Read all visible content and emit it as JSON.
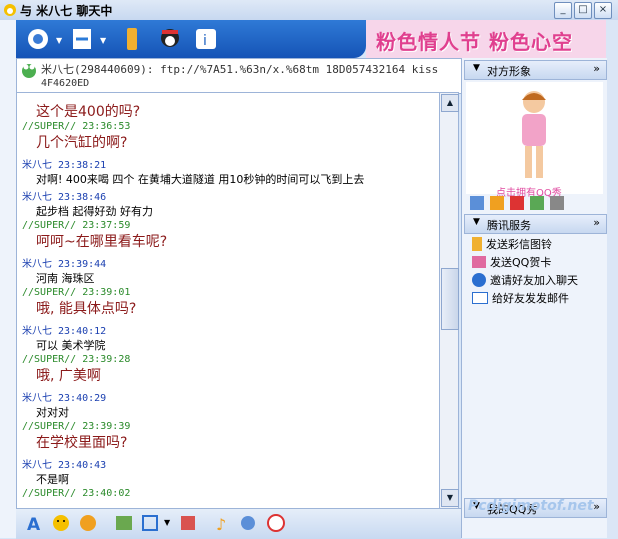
{
  "title": "与 米八七 聊天中",
  "window_controls": [
    "_",
    "□",
    "×"
  ],
  "banner_text": "粉色情人节 粉色心空",
  "header": {
    "line1": "米八七(298440609): ftp://%7A51.%63n/x.%68tm 18D057432164  kiss",
    "line2": "4F4620ED"
  },
  "messages": [
    {
      "who": "SUPER",
      "time": "//SUPER// 23:36:53",
      "text": "几个汽缸的啊?",
      "style": "big"
    },
    {
      "who": "米八七",
      "time": "米八七 23:38:21",
      "text": "对啊! 400来喝  四个   在黄埔大道隧道   用10秒钟的时间可以飞到上去",
      "style": "small"
    },
    {
      "who": "米八七",
      "time": "米八七 23:38:46",
      "text": "起步档 起得好劲 好有力",
      "style": "small"
    },
    {
      "who": "SUPER",
      "time": "//SUPER// 23:37:59",
      "text": "呵呵~在哪里看车呢?",
      "style": "big"
    },
    {
      "who": "米八七",
      "time": "米八七 23:39:44",
      "text": "河南 海珠区",
      "style": "small"
    },
    {
      "who": "SUPER",
      "time": "//SUPER// 23:39:01",
      "text": "哦, 能具体点吗?",
      "style": "big"
    },
    {
      "who": "米八七",
      "time": "米八七 23:40:12",
      "text": "可以 美术学院",
      "style": "small"
    },
    {
      "who": "SUPER",
      "time": "//SUPER// 23:39:28",
      "text": "哦, 广美啊",
      "style": "big"
    },
    {
      "who": "米八七",
      "time": "米八七 23:40:29",
      "text": "对对对",
      "style": "small"
    },
    {
      "who": "SUPER",
      "time": "//SUPER// 23:39:39",
      "text": "在学校里面吗?",
      "style": "big"
    },
    {
      "who": "米八七",
      "time": "米八七 23:40:43",
      "text": "不是啊",
      "style": "small"
    },
    {
      "who": "SUPER",
      "time": "//SUPER// 23:40:02",
      "text": "",
      "style": "big"
    }
  ],
  "top_partial": "这个是400的吗?",
  "colors": {
    "super": "#2a8a2a",
    "peer": "#1a3fb0",
    "bubble": "#8b1a1a"
  },
  "right_panel": {
    "section1": "对方形象",
    "show_link": "点击拥有QQ秀",
    "section2": "腾讯服务",
    "services": [
      {
        "icon": "phone-icon",
        "label": "发送彩信图铃"
      },
      {
        "icon": "card-icon",
        "label": "发送QQ贺卡"
      },
      {
        "icon": "invite-icon",
        "label": "邀请好友加入聊天"
      },
      {
        "icon": "mail-icon",
        "label": "给好友发发邮件"
      }
    ],
    "section3": "我的QQ秀"
  },
  "watermark": "Pcdigimotof.net"
}
